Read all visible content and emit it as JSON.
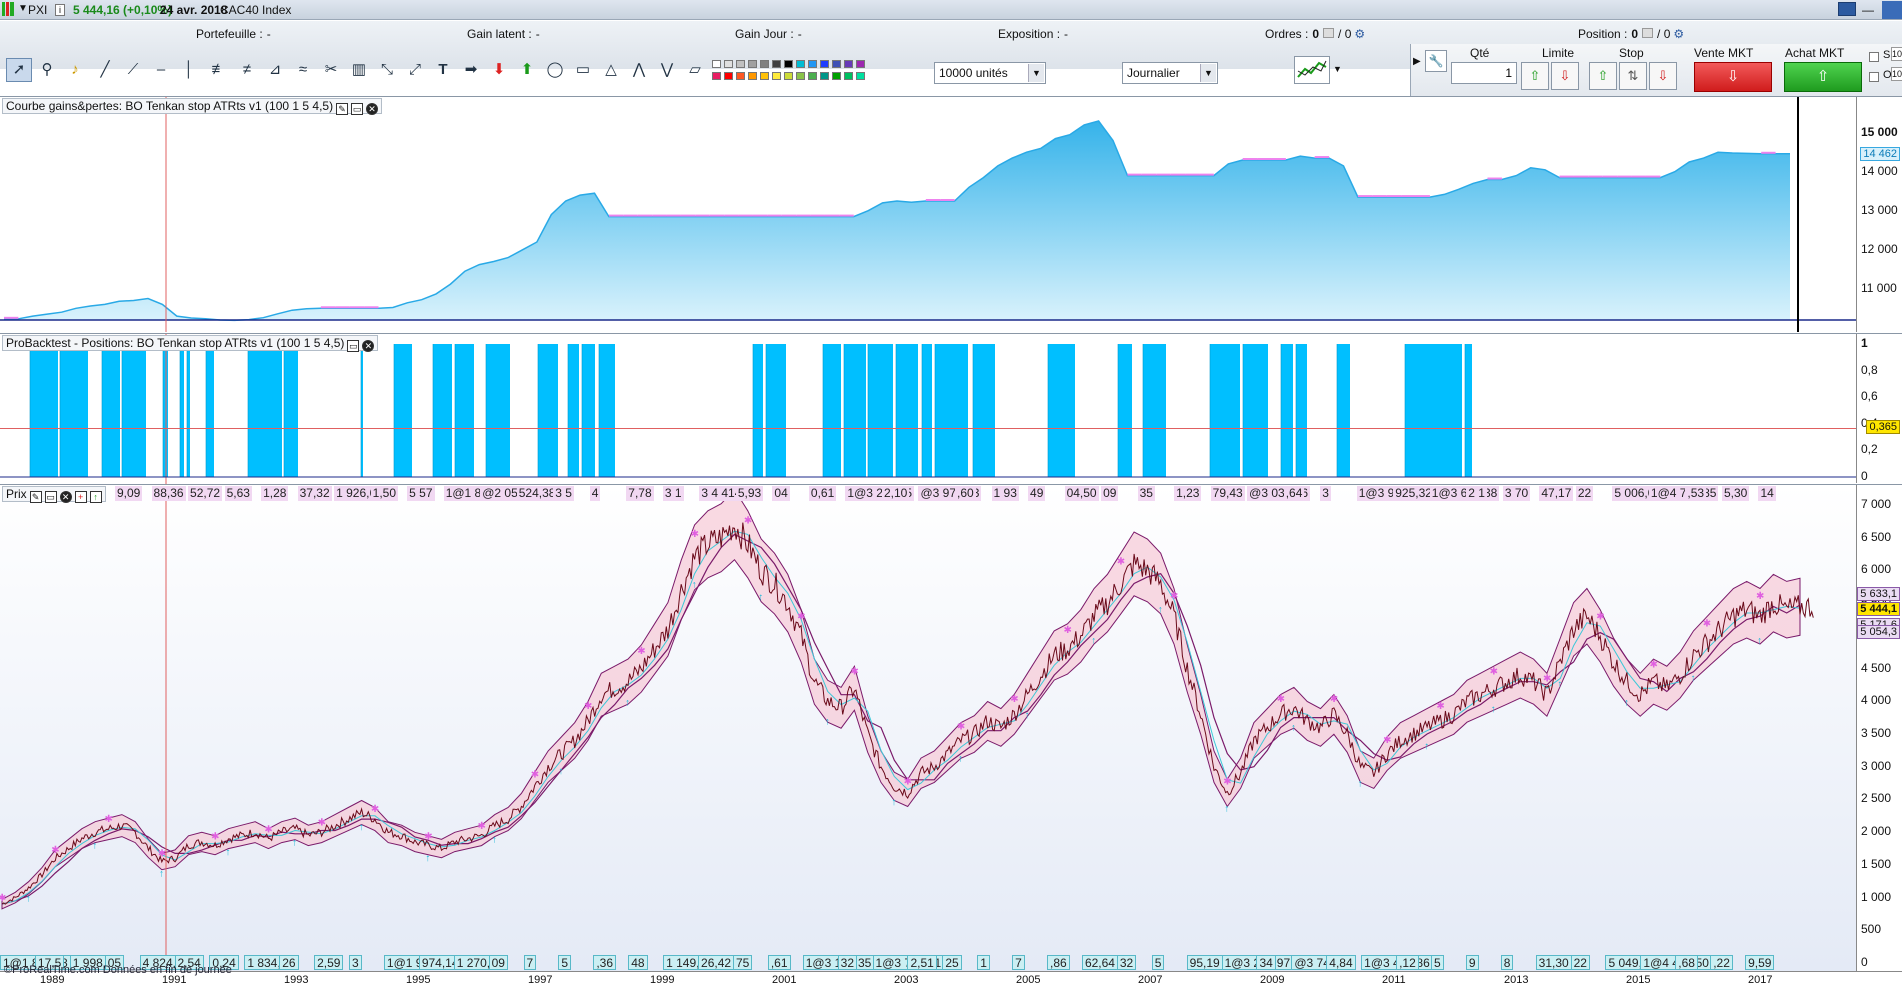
{
  "topbar": {
    "app_code": "PXI",
    "price": "5 444,16 (+0,10%)",
    "date": "24 avr. 2018",
    "instrument": "CAC40 Index"
  },
  "stats": {
    "portefeuille_label": "Portefeuille :",
    "portefeuille_value": "-",
    "gain_latent_label": "Gain latent :",
    "gain_latent_value": "-",
    "gain_jour_label": "Gain Jour :",
    "gain_jour_value": "-",
    "exposition_label": "Exposition :",
    "exposition_value": "-",
    "ordres_label": "Ordres :",
    "ordres_value": "0",
    "ordres_total": "/ 0",
    "position_label": "Position :",
    "position_value": "0",
    "position_total": "/ 0"
  },
  "toolbar": {
    "units": "10000 unités",
    "period": "Journalier"
  },
  "order_panel": {
    "qty_label": "Qté",
    "qty_value": "1",
    "limit_label": "Limite",
    "stop_label": "Stop",
    "sell_label": "Vente MKT",
    "buy_label": "Achat MKT",
    "s_label": "S",
    "o_label": "O",
    "s_value": "10",
    "o_value": "10"
  },
  "panels": {
    "equity_title": "Courbe gains&pertes: BO Tenkan stop ATRts v1 (100 1 5 4,5)",
    "positions_title": "ProBacktest - Positions: BO Tenkan stop ATRts v1 (100 1 5 4,5)",
    "price_title": "Prix"
  },
  "equity_axis": [
    "15 000",
    "14 000",
    "13 000",
    "12 000",
    "11 000"
  ],
  "equity_current": "14 462",
  "positions_axis": [
    "1",
    "0,8",
    "0,6",
    "0,4",
    "0,2",
    "0"
  ],
  "positions_current": "0,365",
  "price_axis": [
    "7 000",
    "6 500",
    "6 000",
    "5 500",
    "5 000",
    "4 500",
    "4 000",
    "3 500",
    "3 000",
    "2 500",
    "2 000",
    "1 500",
    "1 000",
    "500",
    "0"
  ],
  "price_tags": [
    "5 633,1",
    "5 444,1",
    "5 171,6",
    "5 054,3"
  ],
  "top_trade_labels": [
    "9,09",
    "88,36",
    "52,72",
    "5,63",
    "1,28",
    "37,32",
    "1 926,68",
    "1,50",
    "5 57",
    "1@1 868,83",
    "@2 053,58",
    "524,38",
    "3 5",
    "4",
    "7,78",
    "3 1",
    "3 4 414,14",
    "5,93",
    "04",
    "0,61",
    "1@3 211,25",
    "2,10",
    "@3 971,73",
    ",60",
    "1 93",
    "49",
    "04,50",
    "09",
    "35",
    "1,23",
    "79,43",
    "@3 031,86",
    ",64",
    "3",
    "1@3 914,03",
    "925,32",
    "1@3 640,38",
    "2 1",
    "3 70",
    "47,17",
    "22",
    "5 006,01",
    "1@4 786,85",
    ",53",
    "5,30",
    "14"
  ],
  "bottom_trade_labels": [
    "1@1 811,88",
    "17,5",
    "1 998,73",
    "05",
    "4 824,33",
    "2,54",
    "0,24",
    "1 834,71",
    "26",
    "2,59",
    "3",
    "1@1 916,51",
    "974,14",
    "1 270,64",
    "09",
    "7",
    "5",
    ",36",
    "48",
    "1 149,04",
    "26,42",
    "75",
    ",61",
    "1@3 169,35",
    "32",
    "1@3 763,51",
    "2,51",
    "25",
    "1",
    "7",
    ",86",
    "62,64",
    "32",
    "5",
    "95,19",
    "1@3 207,97",
    "34",
    "@3 744,24",
    "4,84",
    "1@3 429,86",
    ",12",
    "5",
    "9",
    "8",
    "31,30",
    "22",
    "5 049,56",
    "1@4 494,50",
    ",68",
    ",22",
    "9,59"
  ],
  "footer": "©ProRealTime.com Données en fin de journée",
  "x_axis": [
    "1989",
    "1991",
    "1993",
    "1995",
    "1997",
    "1999",
    "2001",
    "2003",
    "2005",
    "2007",
    "2009",
    "2011",
    "2013",
    "2015",
    "2017"
  ],
  "colors": {
    "accent": "#00bfff",
    "equity_fill": "#9fdcf7",
    "equity_line": "#29a9e6",
    "flat_line": "#ee82ee",
    "sell": "#d01c1c",
    "buy": "#1f9b1f"
  },
  "equity_series": [
    10230,
    10230,
    10300,
    10350,
    10400,
    10500,
    10560,
    10600,
    10680,
    10700,
    10750,
    10600,
    10300,
    10250,
    10230,
    10200,
    10190,
    10210,
    10260,
    10360,
    10450,
    10490,
    10500,
    10500,
    10500,
    10500,
    10500,
    10520,
    10640,
    10720,
    10870,
    11120,
    11450,
    11620,
    11700,
    11800,
    12000,
    12200,
    12900,
    13250,
    13400,
    13450,
    12850,
    12850,
    12850,
    12850,
    12850,
    12850,
    12850,
    12850,
    12850,
    12850,
    12850,
    12850,
    12850,
    12850,
    12850,
    12850,
    12850,
    12850,
    13000,
    13200,
    13250,
    13220,
    13250,
    13250,
    13250,
    13600,
    13850,
    14150,
    14350,
    14500,
    14600,
    14850,
    14950,
    15200,
    15300,
    14800,
    13900,
    13900,
    13900,
    13900,
    13900,
    13900,
    13900,
    14200,
    14300,
    14300,
    14300,
    14300,
    14400,
    14350,
    14350,
    14150,
    13350,
    13350,
    13350,
    13350,
    13350,
    13350,
    13420,
    13550,
    13700,
    13800,
    13800,
    13900,
    14100,
    14050,
    13850,
    13850,
    13850,
    13850,
    13850,
    13850,
    13850,
    13850,
    14000,
    14250,
    14350,
    14500,
    14480,
    14470,
    14460,
    14460,
    14462
  ],
  "position_bars": [
    [
      30,
      58
    ],
    [
      60,
      88
    ],
    [
      102,
      120
    ],
    [
      122,
      146
    ],
    [
      163,
      168
    ],
    [
      180,
      184
    ],
    [
      187,
      190
    ],
    [
      206,
      214
    ],
    [
      248,
      282
    ],
    [
      284,
      298
    ],
    [
      361,
      363
    ],
    [
      394,
      412
    ],
    [
      433,
      452
    ],
    [
      455,
      474
    ],
    [
      486,
      510
    ],
    [
      538,
      558
    ],
    [
      568,
      579
    ],
    [
      582,
      595
    ],
    [
      599,
      615
    ],
    [
      753,
      763
    ],
    [
      766,
      786
    ],
    [
      823,
      841
    ],
    [
      844,
      866
    ],
    [
      868,
      893
    ],
    [
      896,
      918
    ],
    [
      922,
      932
    ],
    [
      935,
      968
    ],
    [
      973,
      995
    ],
    [
      1048,
      1075
    ],
    [
      1118,
      1132
    ],
    [
      1143,
      1166
    ],
    [
      1210,
      1240
    ],
    [
      1243,
      1268
    ],
    [
      1281,
      1293
    ],
    [
      1296,
      1307
    ],
    [
      1337,
      1350
    ],
    [
      1405,
      1462
    ],
    [
      1465,
      1472
    ]
  ],
  "price_series": [
    900,
    1000,
    1150,
    1350,
    1600,
    1750,
    1900,
    2000,
    2050,
    2100,
    2000,
    1750,
    1550,
    1600,
    1800,
    1850,
    1800,
    1900,
    1950,
    2000,
    1900,
    2000,
    2050,
    1950,
    2000,
    2100,
    2200,
    2300,
    2200,
    2000,
    1950,
    1850,
    1800,
    1750,
    1850,
    1900,
    1950,
    2100,
    2200,
    2400,
    2700,
    3000,
    3200,
    3400,
    3700,
    4100,
    4200,
    4300,
    4500,
    4800,
    5100,
    5700,
    6200,
    6400,
    6500,
    6700,
    6400,
    6000,
    5800,
    5500,
    5000,
    4300,
    4000,
    3900,
    4200,
    3500,
    3000,
    2700,
    2600,
    2900,
    3000,
    3200,
    3400,
    3500,
    3700,
    3600,
    3800,
    4100,
    4400,
    4700,
    4800,
    5000,
    5300,
    5500,
    5800,
    6100,
    6000,
    5800,
    5300,
    4500,
    3800,
    3000,
    2600,
    2900,
    3400,
    3600,
    3800,
    3900,
    3700,
    3600,
    3800,
    3500,
    3000,
    2900,
    3200,
    3400,
    3500,
    3600,
    3700,
    3800,
    4000,
    4100,
    4200,
    4300,
    4400,
    4300,
    4100,
    4600,
    5100,
    5300,
    5000,
    4600,
    4300,
    4100,
    4300,
    4200,
    4400,
    4700,
    4900,
    5100,
    5300,
    5400,
    5300,
    5500,
    5400,
    5444
  ]
}
